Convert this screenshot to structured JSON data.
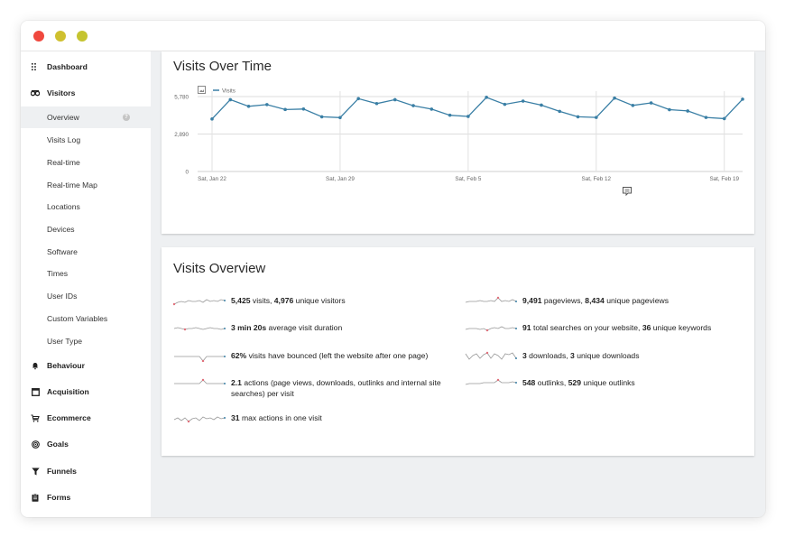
{
  "sidebar": {
    "dashboard": "Dashboard",
    "visitors": "Visitors",
    "visitors_items": [
      "Overview",
      "Visits Log",
      "Real-time",
      "Real-time Map",
      "Locations",
      "Devices",
      "Software",
      "Times",
      "User IDs",
      "Custom Variables",
      "User Type"
    ],
    "behaviour": "Behaviour",
    "acquisition": "Acquisition",
    "ecommerce": "Ecommerce",
    "goals": "Goals",
    "funnels": "Funnels",
    "forms": "Forms"
  },
  "colors": {
    "close": "#f0483e",
    "minimize": "#cfc02f",
    "maximize": "#c5c430",
    "line": "#3a7fa5",
    "sparkline": "#999999",
    "spark_min": "#e0707b"
  },
  "visits_chart": {
    "title": "Visits Over Time",
    "chart_data": {
      "type": "line",
      "legend": "Visits",
      "legend_position": "top-left",
      "yticks": [
        "5,780",
        "2,890",
        "0"
      ],
      "ylim": [
        0,
        5780
      ],
      "xticks": [
        {
          "label": "Sat, Jan 22",
          "index": 0
        },
        {
          "label": "Sat, Jan 29",
          "index": 7
        },
        {
          "label": "Sat, Feb 5",
          "index": 14
        },
        {
          "label": "Sat, Feb 12",
          "index": 21
        },
        {
          "label": "Sat, Feb 19",
          "index": 28
        }
      ],
      "grid": true,
      "series": [
        {
          "name": "Visits",
          "values": [
            4050,
            5540,
            5030,
            5160,
            4780,
            4820,
            4220,
            4160,
            5620,
            5240,
            5540,
            5080,
            4810,
            4340,
            4250,
            5720,
            5180,
            5430,
            5120,
            4640,
            4220,
            4170,
            5660,
            5100,
            5290,
            4770,
            4670,
            4170,
            4080,
            5580
          ]
        }
      ]
    },
    "annotation_icon": "comment-icon",
    "export_icon": "image-export-icon"
  },
  "overview": {
    "title": "Visits Overview",
    "left": [
      {
        "parts": [
          {
            "b": "5,425"
          },
          {
            "t": " visits, "
          },
          {
            "b": "4,976"
          },
          {
            "t": " unique visitors"
          }
        ],
        "spark": [
          2,
          4,
          5,
          4,
          6,
          5,
          5,
          6,
          4,
          7,
          5,
          6,
          5,
          7,
          6
        ],
        "marker": "min"
      },
      {
        "parts": [
          {
            "b": "3 min 20s"
          },
          {
            "t": " average visit duration"
          }
        ],
        "spark": [
          5,
          6,
          5,
          4,
          5,
          5,
          6,
          5,
          4,
          5,
          6,
          5,
          5,
          4,
          5
        ],
        "marker": "min"
      },
      {
        "parts": [
          {
            "b": "62%"
          },
          {
            "t": " visits have bounced (left the website after one page)"
          }
        ],
        "spark": [
          5,
          5,
          5,
          5,
          5,
          5,
          5,
          5,
          0,
          5,
          5,
          5,
          5,
          5,
          5
        ],
        "marker": "min"
      },
      {
        "parts": [
          {
            "b": "2.1"
          },
          {
            "t": " actions (page views, downloads, outlinks and internal site searches) per visit"
          }
        ],
        "spark": [
          5,
          5,
          5,
          5,
          5,
          5,
          5,
          5,
          9,
          5,
          5,
          5,
          5,
          5,
          5
        ],
        "marker": "max"
      },
      {
        "parts": [
          {
            "b": "31"
          },
          {
            "t": " max actions in one visit"
          }
        ],
        "spark": [
          4,
          6,
          3,
          6,
          2,
          5,
          6,
          3,
          7,
          5,
          6,
          4,
          7,
          5,
          6
        ],
        "marker": "min"
      }
    ],
    "right": [
      {
        "parts": [
          {
            "b": "9,491"
          },
          {
            "t": " pageviews, "
          },
          {
            "b": "8,434"
          },
          {
            "t": " unique pageviews"
          }
        ],
        "spark": [
          4,
          5,
          5,
          5,
          6,
          5,
          5,
          6,
          5,
          9,
          5,
          6,
          5,
          7,
          5
        ],
        "marker": "max"
      },
      {
        "parts": [
          {
            "b": "91"
          },
          {
            "t": " total searches on your website, "
          },
          {
            "b": "36"
          },
          {
            "t": " unique keywords"
          }
        ],
        "spark": [
          4,
          5,
          5,
          5,
          4,
          5,
          3,
          5,
          6,
          5,
          7,
          5,
          5,
          6,
          5
        ],
        "marker": "min"
      },
      {
        "parts": [
          {
            "b": "3"
          },
          {
            "t": " downloads, "
          },
          {
            "b": "3"
          },
          {
            "t": " unique downloads"
          }
        ],
        "spark": [
          8,
          2,
          6,
          8,
          3,
          7,
          9,
          3,
          8,
          6,
          2,
          8,
          7,
          9,
          3
        ],
        "marker": "max"
      },
      {
        "parts": [
          {
            "b": "548"
          },
          {
            "t": " outlinks, "
          },
          {
            "b": "529"
          },
          {
            "t": " unique outlinks"
          }
        ],
        "spark": [
          4,
          5,
          5,
          5,
          5,
          6,
          6,
          6,
          6,
          9,
          6,
          6,
          6,
          7,
          6
        ],
        "marker": "max"
      }
    ]
  }
}
